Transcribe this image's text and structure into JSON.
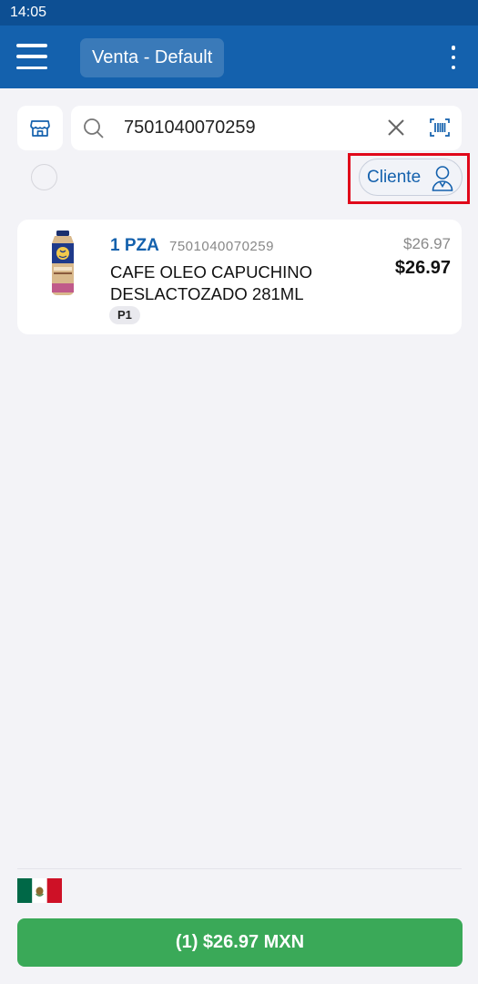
{
  "status_bar": {
    "time": "14:05"
  },
  "app_bar": {
    "title": "Venta - Default"
  },
  "search": {
    "value": "7501040070259"
  },
  "cliente_button": {
    "label": "Cliente"
  },
  "cart": {
    "items": [
      {
        "quantity": "1 PZA",
        "sku": "7501040070259",
        "name": "CAFE OLEO CAPUCHINO DESLACTOZADO 281ML",
        "tag": "P1",
        "original_price": "$26.97",
        "price": "$26.97"
      }
    ]
  },
  "footer": {
    "pay_button": "(1) $26.97 MXN"
  },
  "colors": {
    "status_bar": "#0d4f93",
    "app_bar": "#1461ad",
    "accent": "#1461ad",
    "pay_button": "#3aa958",
    "highlight": "#e0081a"
  }
}
